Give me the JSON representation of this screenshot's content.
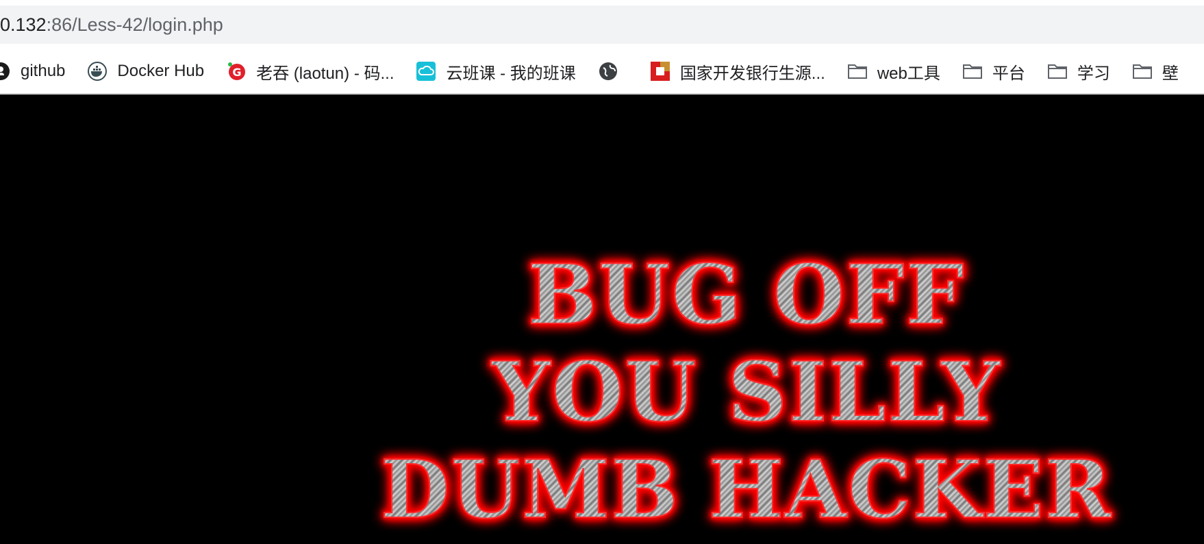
{
  "browser": {
    "url_host": "0.132",
    "url_path": ":86/Less-42/login.php"
  },
  "bookmarks": [
    {
      "label": "github",
      "icon": "github-icon"
    },
    {
      "label": "Docker Hub",
      "icon": "docker-icon"
    },
    {
      "label": "老吞 (laotun) - 码...",
      "icon": "laotun-icon"
    },
    {
      "label": "云班课 - 我的班课",
      "icon": "cloud-class-icon"
    },
    {
      "label": "",
      "icon": "globe-icon"
    },
    {
      "label": "国家开发银行生源...",
      "icon": "bank-icon"
    },
    {
      "label": "web工具",
      "icon": "folder-icon"
    },
    {
      "label": "平台",
      "icon": "folder-icon"
    },
    {
      "label": "学习",
      "icon": "folder-icon"
    },
    {
      "label": "壁",
      "icon": "folder-icon"
    }
  ],
  "page": {
    "banner_lines": [
      "BUG OFF",
      "YOU SILLY",
      "DUMB HACKER"
    ]
  },
  "colors": {
    "background": "#000000",
    "glow": "#ff0000"
  }
}
